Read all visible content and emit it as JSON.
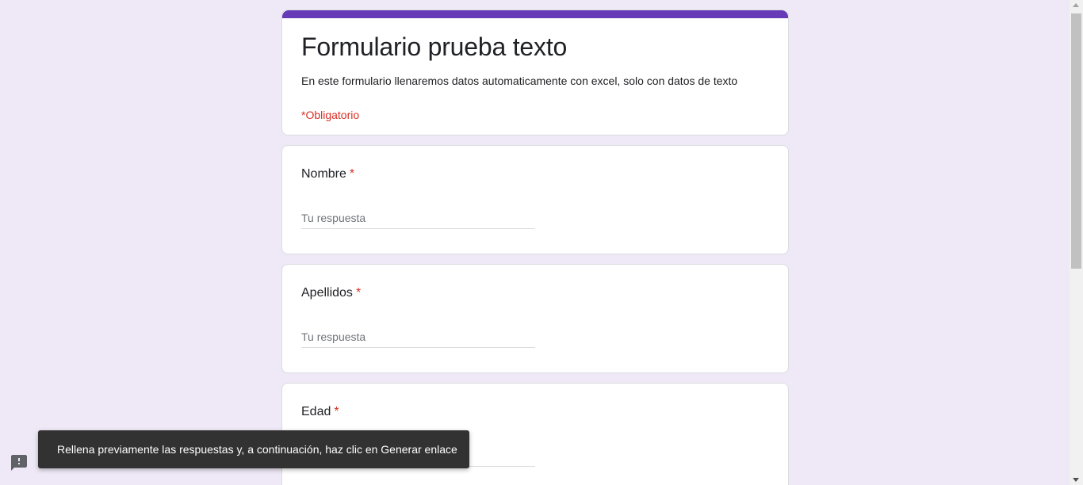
{
  "form": {
    "title": "Formulario prueba texto",
    "description": "En este formulario llenaremos datos automaticamente con excel, solo con datos de texto",
    "required_note": "*Obligatorio",
    "accent_color": "#673ab7",
    "required_color": "#d93025"
  },
  "questions": [
    {
      "label": "Nombre",
      "required_mark": "*",
      "placeholder": "Tu respuesta",
      "value": ""
    },
    {
      "label": "Apellidos",
      "required_mark": "*",
      "placeholder": "Tu respuesta",
      "value": ""
    },
    {
      "label": "Edad",
      "required_mark": "*",
      "placeholder": "Tu respuesta",
      "value": ""
    }
  ],
  "toast": {
    "message": "Rellena previamente las respuestas y, a continuación, haz clic en Generar enlace"
  },
  "icons": {
    "feedback": "feedback-icon"
  }
}
